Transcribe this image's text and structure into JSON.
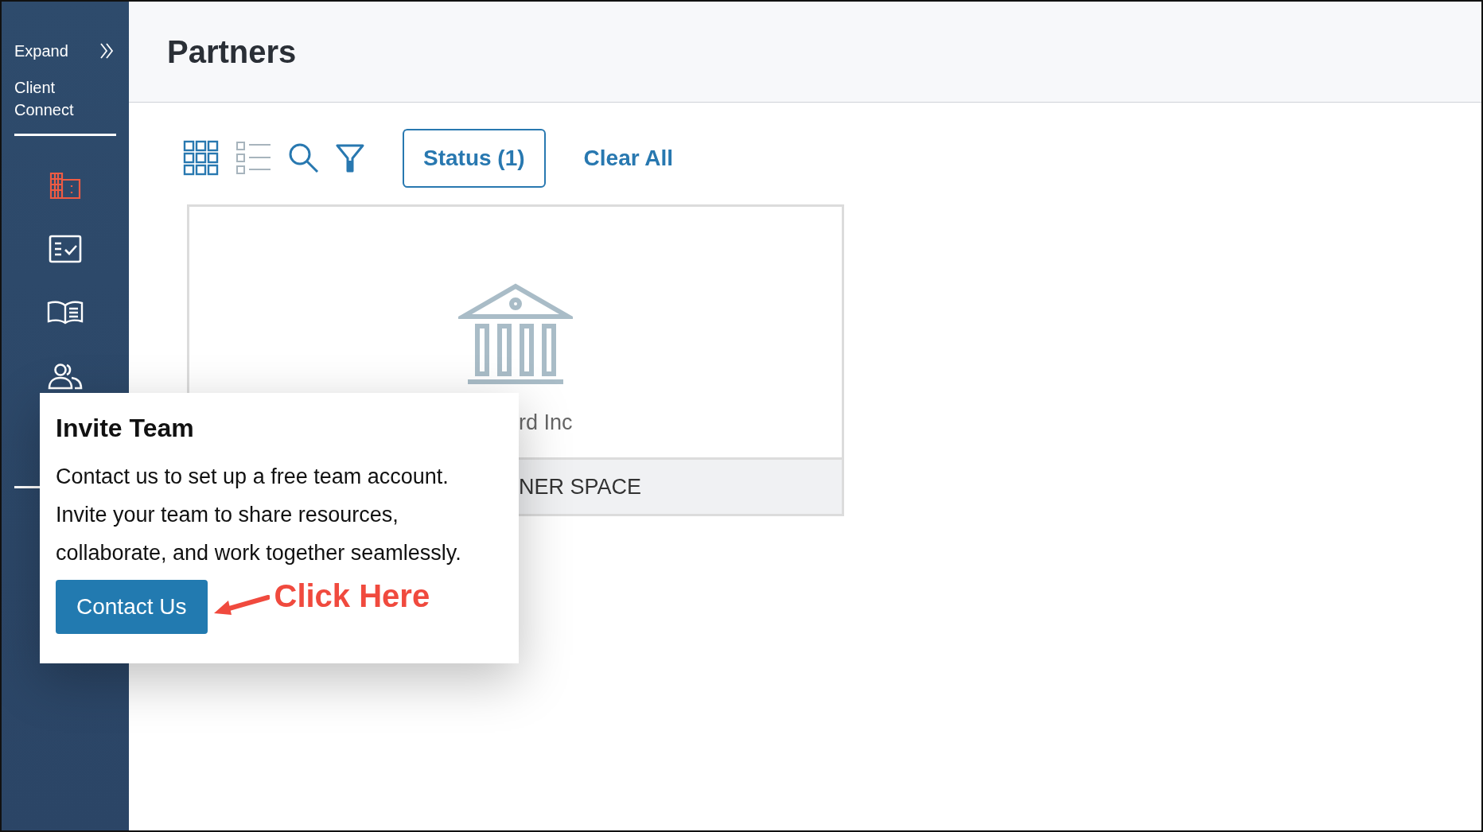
{
  "sidebar": {
    "expand_label": "Expand",
    "app_name": "Client Connect",
    "items": [
      {
        "kind": "building",
        "selected": true
      },
      {
        "kind": "checklist",
        "selected": false
      },
      {
        "kind": "book",
        "selected": false
      },
      {
        "kind": "people",
        "selected": false
      }
    ]
  },
  "header": {
    "title": "Partners"
  },
  "toolbar": {
    "views": [
      {
        "kind": "grid",
        "selected": true
      },
      {
        "kind": "list",
        "selected": false
      }
    ],
    "status_button": "Status (1)",
    "clear_all": "Clear All"
  },
  "cards": [
    {
      "name": "rd Inc",
      "footer": "NER SPACE"
    }
  ],
  "popup": {
    "title": "Invite Team",
    "body": "Contact us to set up a free team account. Invite your team to share resources, collaborate, and work together seamlessly.",
    "button": "Contact Us"
  },
  "annotation": {
    "text": "Click Here"
  }
}
